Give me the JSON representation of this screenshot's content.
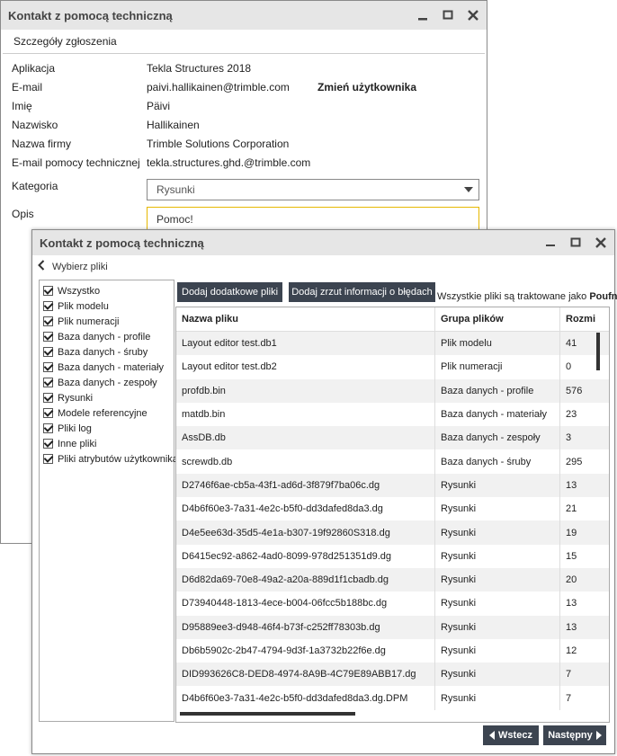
{
  "back_window": {
    "title": "Kontakt z pomocą techniczną",
    "subheader": "Szczegóły zgłoszenia",
    "fields": [
      {
        "label": "Aplikacja",
        "value": "Tekla Structures 2018"
      },
      {
        "label": "E-mail",
        "value": "paivi.hallikainen@trimble.com"
      },
      {
        "label": "Imię",
        "value": "Päivi"
      },
      {
        "label": "Nazwisko",
        "value": "Hallikainen"
      },
      {
        "label": "Nazwa firmy",
        "value": "Trimble Solutions Corporation"
      },
      {
        "label": "E-mail pomocy technicznej",
        "value": "tekla.structures.ghd.@trimble.com"
      }
    ],
    "change_user_link": "Zmień użytkownika",
    "category_label": "Kategoria",
    "category_value": "Rysunki",
    "description_label": "Opis",
    "description_value": "Pomoc!"
  },
  "front_window": {
    "title": "Kontakt z pomocą techniczną",
    "back_label": "Wybierz pliki",
    "checkboxes": [
      "Wszystko",
      "Plik modelu",
      "Plik numeracji",
      "Baza danych - profile",
      "Baza danych - śruby",
      "Baza danych - materiały",
      "Baza danych - zespoły",
      "Rysunki",
      "Modele referencyjne",
      "Pliki log",
      "Inne pliki",
      "Pliki atrybutów użytkownika"
    ],
    "add_files_button": "Dodaj dodatkowe pliki",
    "add_dump_button": "Dodaj zrzut informacji o błędach",
    "confidential_prefix": "Wszystkie pliki są traktowane jako",
    "confidential_word": "Poufne",
    "columns": [
      "Nazwa pliku",
      "Grupa plików",
      "Rozmi"
    ],
    "rows": [
      [
        "Layout editor test.db1",
        "Plik modelu",
        "41"
      ],
      [
        "Layout editor test.db2",
        "Plik numeracji",
        "0"
      ],
      [
        "profdb.bin",
        "Baza danych - profile",
        "576"
      ],
      [
        "matdb.bin",
        "Baza danych - materiały",
        "23"
      ],
      [
        "AssDB.db",
        "Baza danych - zespoły",
        "3"
      ],
      [
        "screwdb.db",
        "Baza danych - śruby",
        "295"
      ],
      [
        "D2746f6ae-cb5a-43f1-ad6d-3f879f7ba06c.dg",
        "Rysunki",
        "13"
      ],
      [
        "D4b6f60e3-7a31-4e2c-b5f0-dd3dafed8da3.dg",
        "Rysunki",
        "21"
      ],
      [
        "D4e5ee63d-35d5-4e1a-b307-19f92860S318.dg",
        "Rysunki",
        "19"
      ],
      [
        "D6415ec92-a862-4ad0-8099-978d251351d9.dg",
        "Rysunki",
        "15"
      ],
      [
        "D6d82da69-70e8-49a2-a20a-889d1f1cbadb.dg",
        "Rysunki",
        "20"
      ],
      [
        "D73940448-1813-4ece-b004-06fcc5b188bc.dg",
        "Rysunki",
        "13"
      ],
      [
        "D95889ee3-d948-46f4-b73f-c252ff78303b.dg",
        "Rysunki",
        "13"
      ],
      [
        "Db6b5902c-2b47-4794-9d3f-1a3732b22f6e.dg",
        "Rysunki",
        "12"
      ],
      [
        "DID993626C8-DED8-4974-8A9B-4C79E89ABB17.dg",
        "Rysunki",
        "7"
      ],
      [
        "D4b6f60e3-7a31-4e2c-b5f0-dd3dafed8da3.dg.DPM",
        "Rysunki",
        "7"
      ]
    ],
    "back_button": "Wstecz",
    "next_button": "Następny"
  }
}
